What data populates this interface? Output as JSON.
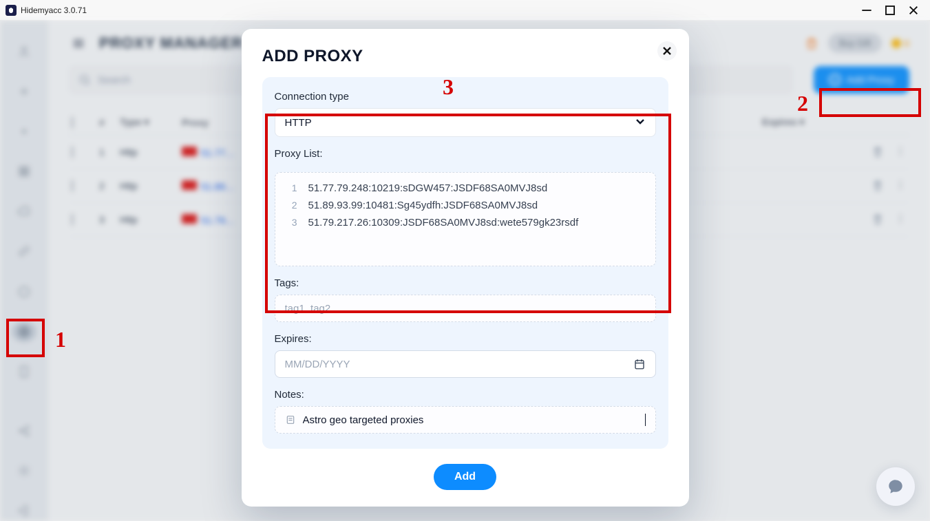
{
  "window": {
    "title": "Hidemyacc 3.0.71"
  },
  "page_title": "PROXY MANAGER",
  "header": {
    "buy_label": "Buy Gift",
    "coin_value": "0",
    "search_placeholder": "Search",
    "add_proxy_label": "Add Proxy"
  },
  "table": {
    "headers": {
      "index": "#",
      "type": "Type",
      "proxy": "Proxy",
      "expires": "Expires"
    },
    "rows": [
      {
        "idx": "1",
        "type": "Http",
        "proxy": "51.77…"
      },
      {
        "idx": "2",
        "type": "Http",
        "proxy": "51.89…"
      },
      {
        "idx": "3",
        "type": "Http",
        "proxy": "51.79…"
      }
    ]
  },
  "modal": {
    "title": "ADD PROXY",
    "conn_type_label": "Connection type",
    "conn_type_value": "HTTP",
    "proxy_list_label": "Proxy List:",
    "proxy_lines": [
      "51.77.79.248:10219:sDGW457:JSDF68SA0MVJ8sd",
      "51.89.93.99:10481:Sg45ydfh:JSDF68SA0MVJ8sd",
      "51.79.217.26:10309:JSDF68SA0MVJ8sd:wete579gk23rsdf"
    ],
    "tags_label": "Tags:",
    "tags_placeholder": "tag1, tag2, ...",
    "expires_label": "Expires:",
    "expires_placeholder": "MM/DD/YYYY",
    "notes_label": "Notes:",
    "notes_value": "Astro geo targeted proxies",
    "add_btn": "Add"
  },
  "annotations": {
    "one": "1",
    "two": "2",
    "three": "3"
  }
}
